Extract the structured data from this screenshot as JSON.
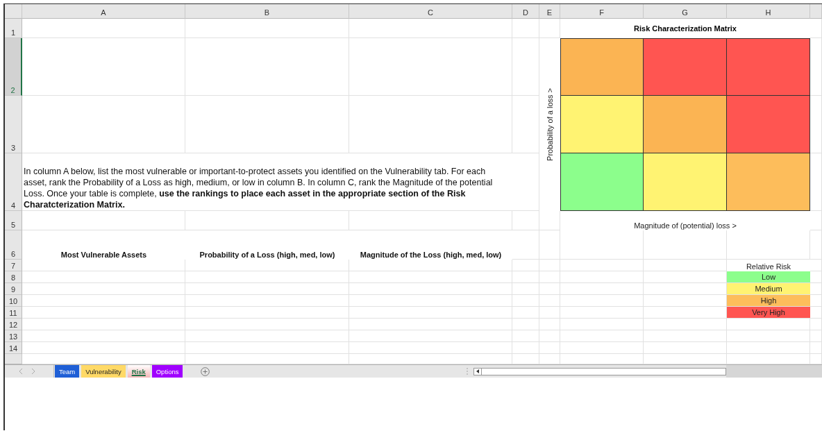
{
  "column_headers": [
    "A",
    "B",
    "C",
    "D",
    "E",
    "F",
    "G",
    "H"
  ],
  "row_headers": [
    {
      "label": "1",
      "selected": false
    },
    {
      "label": "2",
      "selected": true
    },
    {
      "label": "3",
      "selected": false
    },
    {
      "label": "4",
      "selected": false
    },
    {
      "label": "5",
      "selected": false
    },
    {
      "label": "6",
      "selected": false
    },
    {
      "label": "7",
      "selected": false
    },
    {
      "label": "8",
      "selected": false
    },
    {
      "label": "9",
      "selected": false
    },
    {
      "label": "10",
      "selected": false
    },
    {
      "label": "11",
      "selected": false
    },
    {
      "label": "12",
      "selected": false
    },
    {
      "label": "13",
      "selected": false
    },
    {
      "label": "14",
      "selected": false
    }
  ],
  "instructions": "In column A below, list the most vulnerable or important-to-protect assets you identified on the Vulnerability tab. For each asset, rank the Probability of a Loss as high, medium, or low in column B. In column C, rank the Magnitude of the potential Loss. Once your table is complete, **use the rankings to place each asset in the appropriate section of the Risk Charatcterization Matrix.**",
  "table_headers": [
    "Most Vulnerable Assets",
    "Probability of a Loss (high, med, low)",
    "Magnitude of the Loss (high, med, low)"
  ],
  "matrix": {
    "title": "Risk Characterization Matrix",
    "y_axis_label": "Probability of a loss >",
    "x_axis_label": "Magnitude of (potential) loss >",
    "cells": [
      [
        {
          "color": "#fbb453"
        },
        {
          "color": "#ff5551"
        },
        {
          "color": "#ff5551"
        }
      ],
      [
        {
          "color": "#fff372"
        },
        {
          "color": "#fbb453"
        },
        {
          "color": "#ff5551"
        }
      ],
      [
        {
          "color": "#8cfe8c"
        },
        {
          "color": "#fff372"
        },
        {
          "color": "#fdbd5b"
        }
      ]
    ]
  },
  "legend": {
    "title": "Relative Risk",
    "items": [
      {
        "label": "Low",
        "color": "#8cfe8c"
      },
      {
        "label": "Medium",
        "color": "#fff372"
      },
      {
        "label": "High",
        "color": "#fdbd5b"
      },
      {
        "label": "Very High",
        "color": "#ff5551"
      }
    ]
  },
  "sheet_tabs": [
    {
      "label": "Team",
      "color": "#1f5fd6",
      "selected": false
    },
    {
      "label": "Vulnerability",
      "color": "#ffd966",
      "selected": false
    },
    {
      "label": "Risk",
      "color": "#f4b6b6",
      "selected": true
    },
    {
      "label": "Options",
      "color": "#a000ff",
      "selected": false
    }
  ]
}
